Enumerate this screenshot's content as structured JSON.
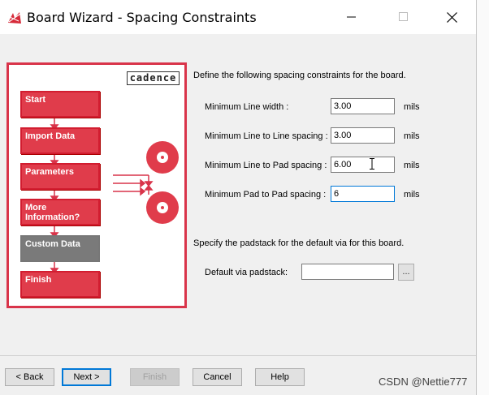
{
  "window": {
    "title": "Board Wizard - Spacing Constraints"
  },
  "flowchart": {
    "logo": "cadence",
    "steps": [
      {
        "label": "Start",
        "state": "normal"
      },
      {
        "label": "Import Data",
        "state": "normal"
      },
      {
        "label": "Parameters",
        "state": "normal"
      },
      {
        "label": "More Information?",
        "state": "normal"
      },
      {
        "label": "Custom Data",
        "state": "inactive"
      },
      {
        "label": "Finish",
        "state": "normal"
      }
    ]
  },
  "spacing": {
    "intro": "Define the following spacing constraints for the board.",
    "fields": [
      {
        "label": "Minimum Line width :",
        "value": "3.00",
        "unit": "mils"
      },
      {
        "label": "Minimum Line to Line spacing :",
        "value": "3.00",
        "unit": "mils"
      },
      {
        "label": "Minimum Line to Pad spacing :",
        "value": "6.00",
        "unit": "mils"
      },
      {
        "label": "Minimum Pad to Pad spacing :",
        "value": "6",
        "unit": "mils"
      }
    ]
  },
  "padstack": {
    "intro": "Specify the padstack for the default via for this board.",
    "label": "Default via padstack:",
    "value": "",
    "browse_label": "..."
  },
  "buttons": {
    "back": "< Back",
    "next": "Next >",
    "finish": "Finish",
    "cancel": "Cancel",
    "help": "Help"
  },
  "watermark": "CSDN @Nettie777",
  "colors": {
    "flow_red": "#e03c4b",
    "flow_border": "#d9344a",
    "focus_blue": "#0078d7"
  }
}
